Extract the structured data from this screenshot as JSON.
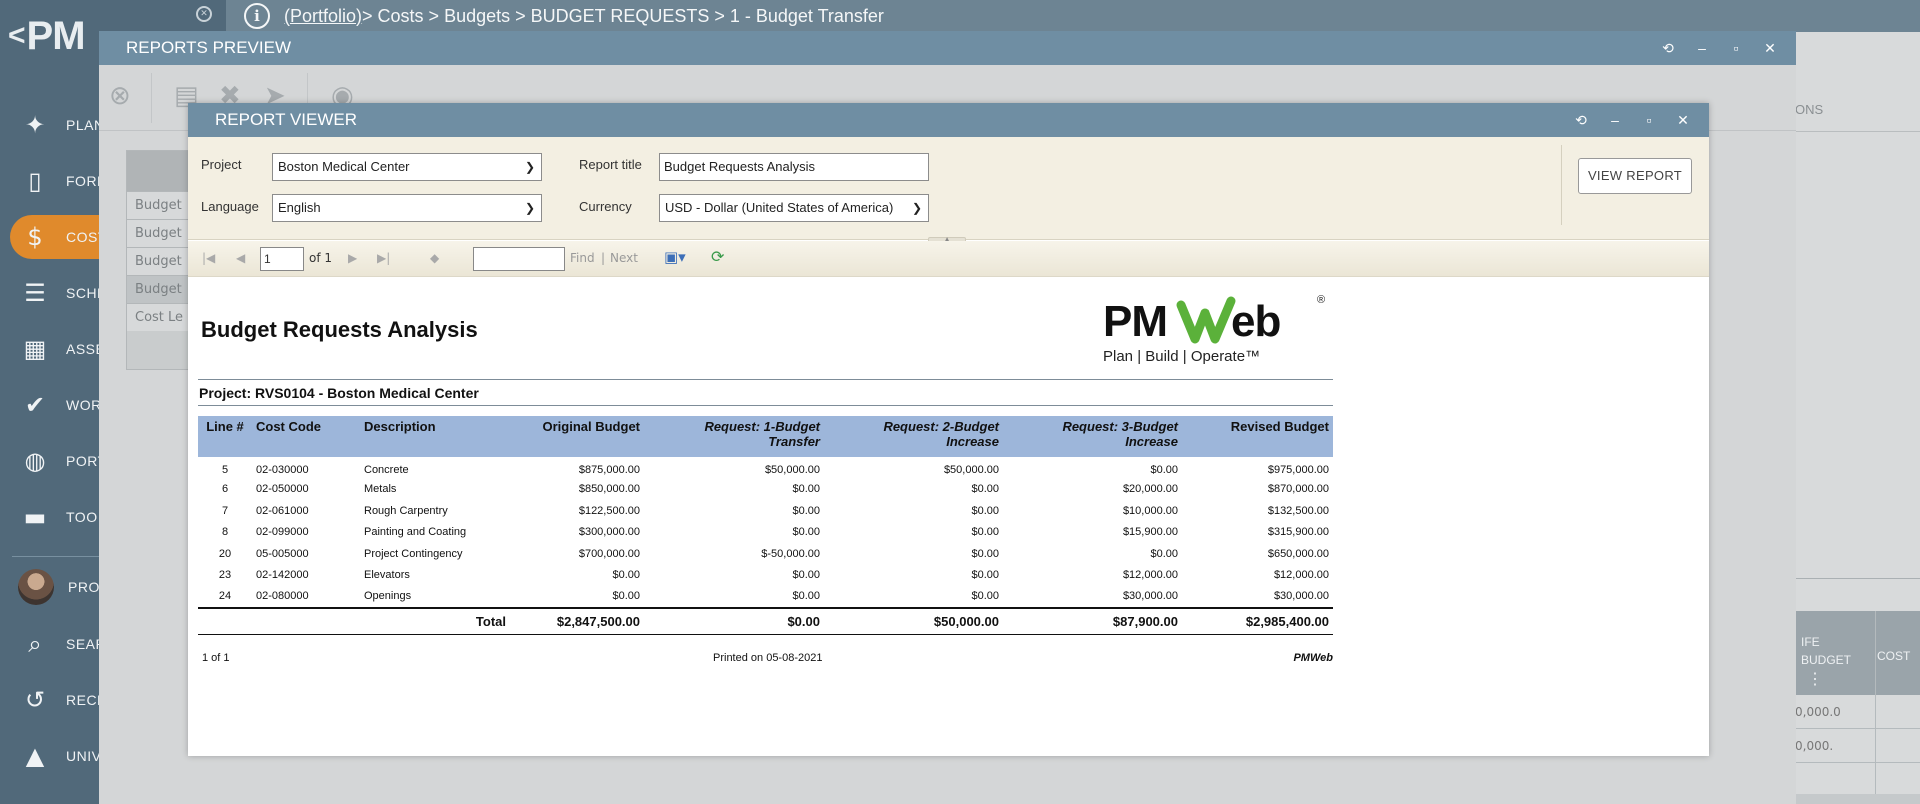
{
  "sidebar": {
    "logo": "PM",
    "items": [
      {
        "label": "PLAN",
        "icon": "lightbulb-icon"
      },
      {
        "label": "FORM",
        "icon": "document-icon"
      },
      {
        "label": "COST",
        "icon": "dollar-icon"
      },
      {
        "label": "SCHE",
        "icon": "schedule-icon"
      },
      {
        "label": "ASSE",
        "icon": "building-icon"
      },
      {
        "label": "WOR",
        "icon": "checkmark-icon"
      },
      {
        "label": "PORT",
        "icon": "globe-icon"
      },
      {
        "label": "TOO",
        "icon": "briefcase-icon"
      },
      {
        "label": "PROF",
        "icon": "avatar"
      },
      {
        "label": "SEAR",
        "icon": "search-icon"
      },
      {
        "label": "RECE",
        "icon": "history-icon"
      },
      {
        "label": "UNIV",
        "icon": "graduation-cap-icon"
      }
    ]
  },
  "topbar": {
    "portfolio_link": "(Portfolio)",
    "breadcrumb_rest": " > Costs > Budgets > BUDGET REQUESTS > 1 - Budget Transfer"
  },
  "background": {
    "right_tab_text": "ONS",
    "grid_header_col1": "IFE\nBUDGET",
    "grid_header_col2": "COST",
    "grid_cell_1": "0,000.0",
    "grid_cell_2": "0,000."
  },
  "reports_preview": {
    "title": "REPORTS PREVIEW",
    "left_list": [
      "Budget",
      "Budget",
      "Budget",
      "Budget",
      "Cost Le"
    ]
  },
  "viewer": {
    "title": "REPORT VIEWER",
    "params": {
      "project_label": "Project",
      "project_value": "Boston Medical Center",
      "language_label": "Language",
      "language_value": "English",
      "report_title_label": "Report title",
      "report_title_value": "Budget Requests Analysis",
      "currency_label": "Currency",
      "currency_value": "USD - Dollar (United States of America)",
      "view_report_button": "VIEW REPORT"
    },
    "toolbar": {
      "page_value": "1",
      "page_of": "of 1",
      "find_label": "Find",
      "separator": "|",
      "next_label": "Next"
    }
  },
  "report": {
    "title": "Budget Requests Analysis",
    "logo_text": "PMWeb",
    "logo_tagline": "Plan | Build | Operate™",
    "logo_registered": "®",
    "project_line": "Project:  RVS0104 - Boston Medical Center",
    "headers": [
      "Line #",
      "Cost Code",
      "Description",
      "Original Budget",
      "Request: 1-Budget Transfer",
      "Request: 2-Budget Increase",
      "Request: 3-Budget Increase",
      "Revised Budget"
    ],
    "rows": [
      [
        "5",
        "02-030000",
        "Concrete",
        "$875,000.00",
        "$50,000.00",
        "$50,000.00",
        "$0.00",
        "$975,000.00"
      ],
      [
        "6",
        "02-050000",
        "Metals",
        "$850,000.00",
        "$0.00",
        "$0.00",
        "$20,000.00",
        "$870,000.00"
      ],
      [
        "7",
        "02-061000",
        "Rough Carpentry",
        "$122,500.00",
        "$0.00",
        "$0.00",
        "$10,000.00",
        "$132,500.00"
      ],
      [
        "8",
        "02-099000",
        "Painting and Coating",
        "$300,000.00",
        "$0.00",
        "$0.00",
        "$15,900.00",
        "$315,900.00"
      ],
      [
        "20",
        "05-005000",
        "Project Contingency",
        "$700,000.00",
        "$-50,000.00",
        "$0.00",
        "$0.00",
        "$650,000.00"
      ],
      [
        "23",
        "02-142000",
        "Elevators",
        "$0.00",
        "$0.00",
        "$0.00",
        "$12,000.00",
        "$12,000.00"
      ],
      [
        "24",
        "02-080000",
        "Openings",
        "$0.00",
        "$0.00",
        "$0.00",
        "$30,000.00",
        "$30,000.00"
      ]
    ],
    "total": {
      "label": "Total",
      "original": "$2,847,500.00",
      "req1": "$0.00",
      "req2": "$50,000.00",
      "req3": "$87,900.00",
      "revised": "$2,985,400.00"
    },
    "footer": {
      "page": "1 of 1",
      "printed": "Printed on 05-08-2021",
      "brand": "PMWeb"
    }
  },
  "colors": {
    "accent_orange": "#e08a2c",
    "titlebar_blue": "#6f8ea3",
    "table_header": "#9db6da"
  }
}
